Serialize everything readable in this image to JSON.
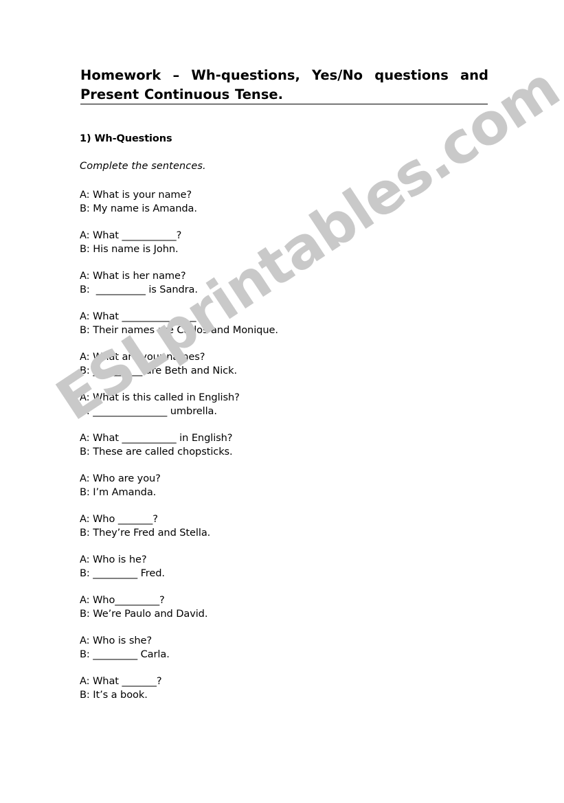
{
  "document": {
    "title": "Homework – Wh-questions, Yes/No questions and Present Continuous Tense.",
    "watermark": "ESLprintables.com",
    "watermark_color": "#c9c9c9",
    "background_color": "#ffffff",
    "text_color": "#000000"
  },
  "section": {
    "heading": "1) Wh-Questions",
    "instruction": "Complete the sentences."
  },
  "dialogues": [
    {
      "a": "A: What is your name?",
      "b": "B: My name is Amanda."
    },
    {
      "a": "A: What ___________?",
      "b": "B: His name is John."
    },
    {
      "a": "A: What is her name?",
      "b": "B:  __________ is Sandra."
    },
    {
      "a": "A: What _______________?",
      "b": "B: Their names are Carlos and Monique."
    },
    {
      "a": "A: What are your names?",
      "b": "B: __________ are Beth and Nick."
    },
    {
      "a": "A: What is this called in English?",
      "b": "B: _______________ umbrella."
    },
    {
      "a": "A: What ___________ in English?",
      "b": "B: These are called chopsticks."
    },
    {
      "a": "A: Who are you?",
      "b": "B: I’m Amanda."
    },
    {
      "a": "A: Who _______?",
      "b": "B: They’re Fred and Stella."
    },
    {
      "a": "A: Who is he?",
      "b": "B: _________ Fred."
    },
    {
      "a": "A: Who_________?",
      "b": "B: We’re Paulo and David."
    },
    {
      "a": "A: Who is she?",
      "b": "B: _________ Carla."
    },
    {
      "a": "A: What _______?",
      "b": "B: It’s a book."
    }
  ]
}
